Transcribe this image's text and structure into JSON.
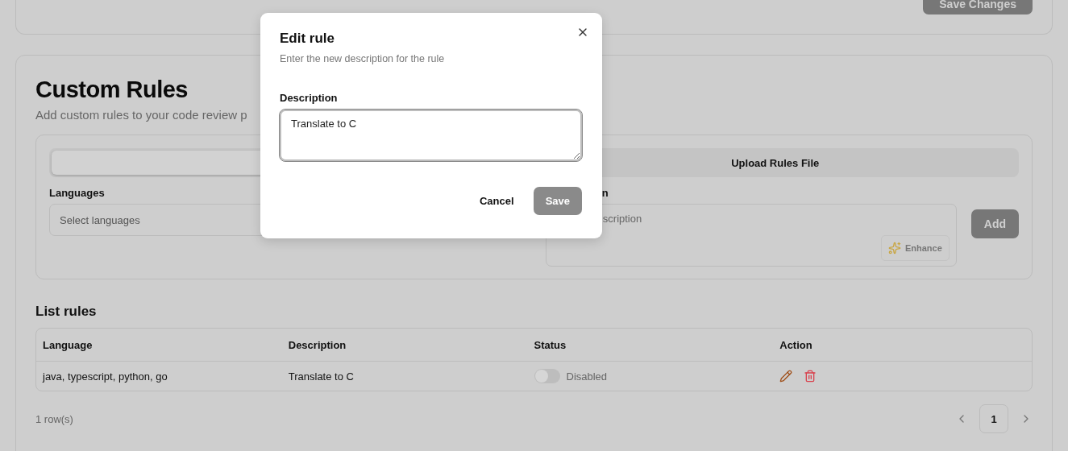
{
  "settings_card": {
    "save_button": "Save Changes"
  },
  "custom_rules": {
    "title": "Custom Rules",
    "subtitle": "Add custom rules to your code review p",
    "tabs": [
      {
        "selected": true
      },
      {
        "label": "Upload Rules File",
        "selected": false
      }
    ],
    "languages": {
      "label": "Languages",
      "placeholder": "Select languages"
    },
    "description": {
      "label": "n",
      "placeholder": "scription"
    },
    "enhance_button": "Enhance",
    "add_button": "Add"
  },
  "list": {
    "title": "List rules",
    "columns": [
      "Language",
      "Description",
      "Status",
      "Action"
    ],
    "rows": [
      {
        "language": "java, typescript, python, go",
        "description": "Translate to C",
        "status": {
          "on": false,
          "label": "Disabled"
        }
      }
    ],
    "row_count": "1 row(s)",
    "pages": [
      {
        "label": "1",
        "selected": true
      }
    ]
  },
  "dialog": {
    "title": "Edit rule",
    "subtitle": "Enter the new description for the rule",
    "field_label": "Description",
    "value": "Translate to C",
    "cancel": "Cancel",
    "save": "Save"
  }
}
